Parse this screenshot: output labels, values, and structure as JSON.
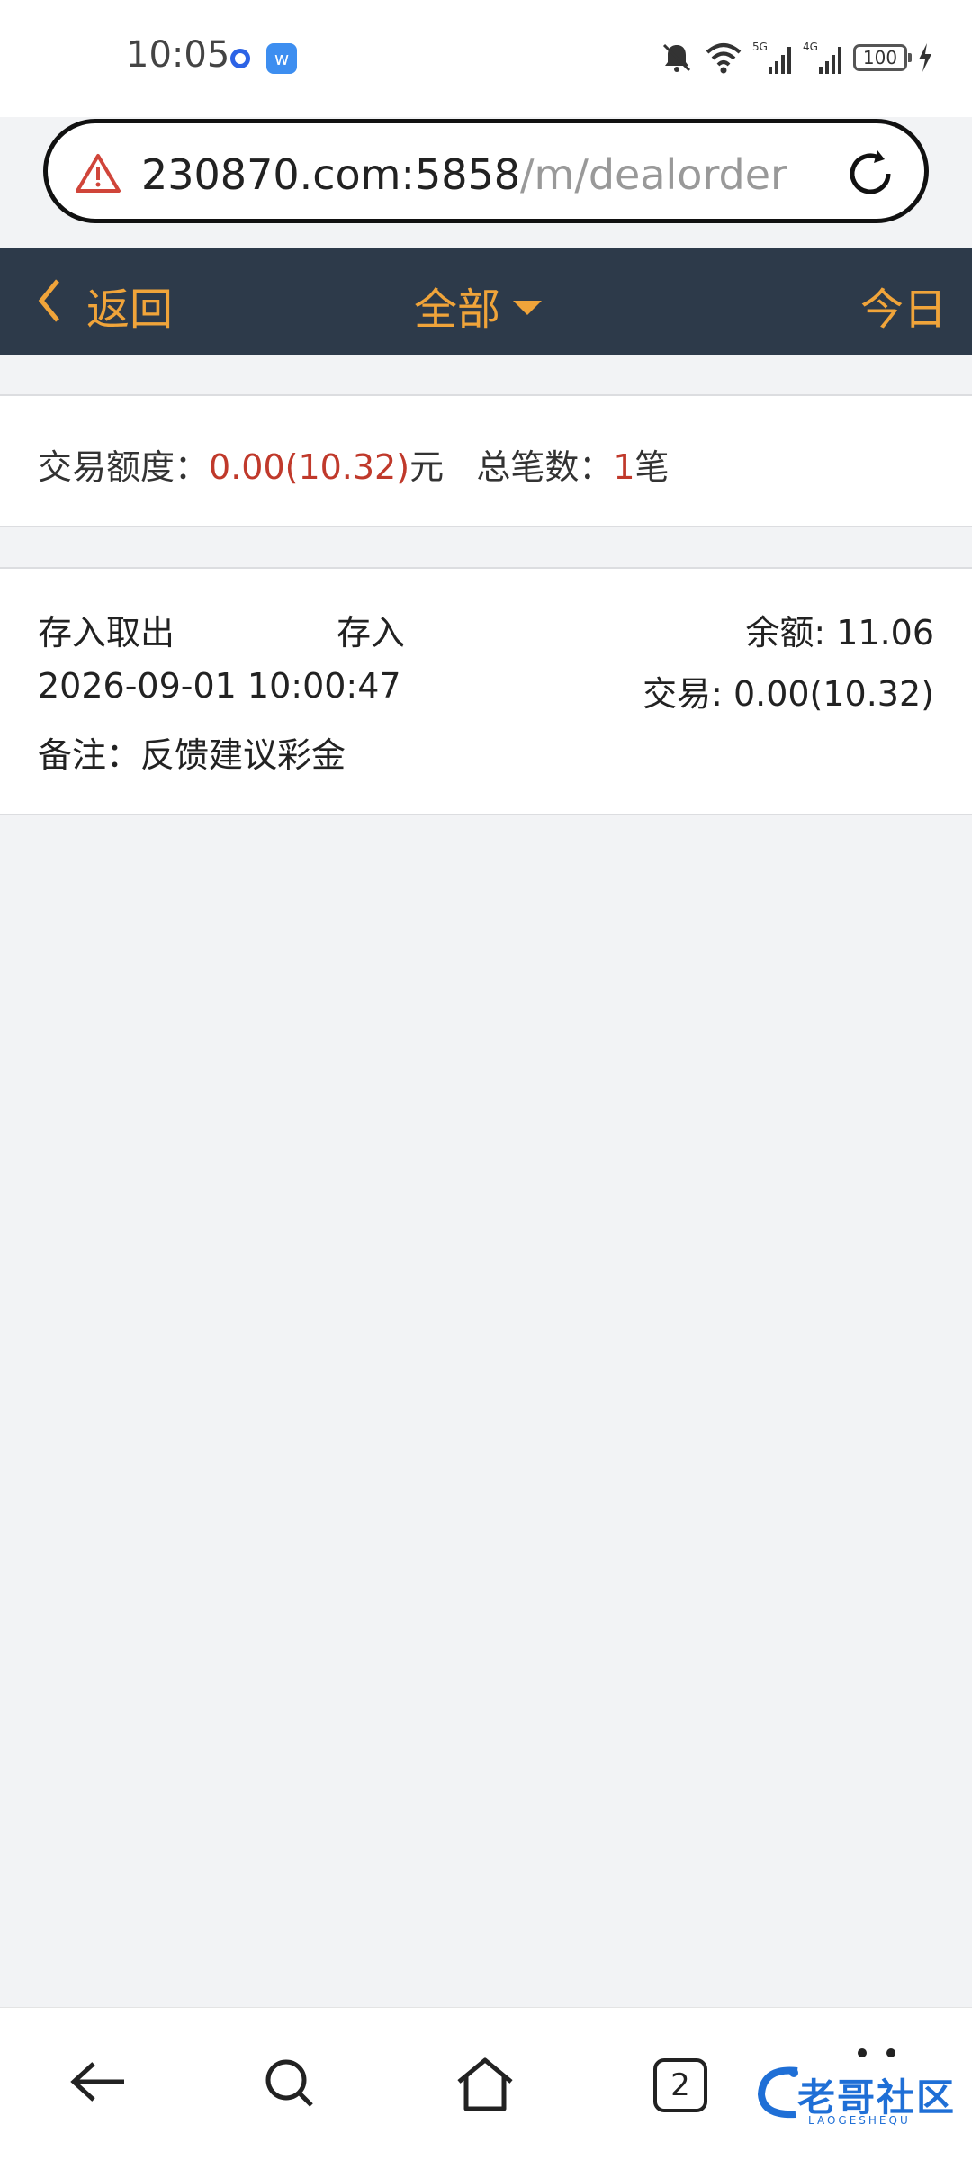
{
  "status_bar": {
    "time": "10:05",
    "icons": [
      "app-badge-icon",
      "app-w-icon",
      "mute-bell-icon",
      "wifi-icon",
      "signal-5g-icon",
      "signal-4g-icon",
      "battery-icon",
      "charging-icon"
    ],
    "battery_level": "100",
    "network1": "5G",
    "network2": "4G"
  },
  "browser": {
    "url_host": "230870.com:5858",
    "url_path": "/m/dealorder"
  },
  "header": {
    "back_label": "返回",
    "filter_label": "全部",
    "today_label": "今日"
  },
  "summary": {
    "amount_label": "交易额度：",
    "amount_value": "0.00(10.32)",
    "amount_unit": "元",
    "count_label": "总笔数：",
    "count_value": "1",
    "count_unit": "笔"
  },
  "records": [
    {
      "category": "存入取出",
      "type": "存入",
      "balance": "余额: 11.06",
      "datetime": "2026-09-01 10:00:47",
      "amount": "交易: 0.00(10.32)",
      "note": "备注：反馈建议彩金"
    }
  ],
  "bottom_nav": {
    "tab_count": "2",
    "watermark": "老哥社区",
    "watermark_sub": "LAOGESHEQU"
  },
  "colors": {
    "accent": "#f0a43a",
    "header_bg": "#2d3a4a",
    "highlight_red": "#c0392b",
    "page_bg": "#f2f3f5"
  }
}
